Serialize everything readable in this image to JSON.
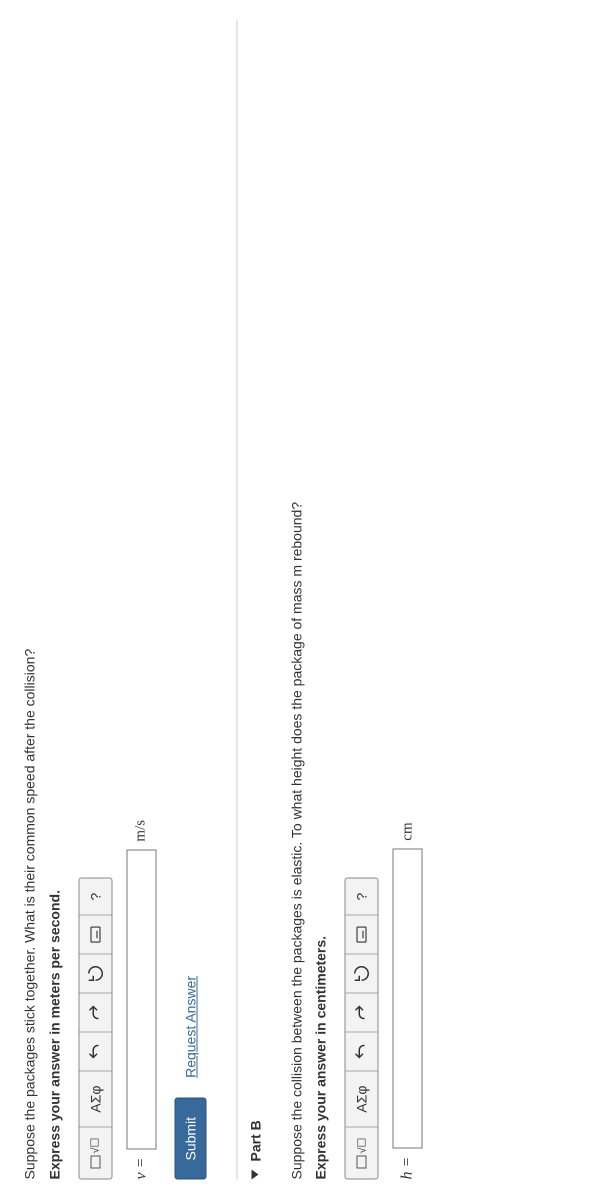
{
  "partA": {
    "question": "Suppose the packages stick together. What is their common speed after the collision?",
    "instruction": "Express your answer in meters per second.",
    "toolbar": {
      "templates": "",
      "symbols": "ΑΣφ",
      "undo": "",
      "redo": "",
      "reset": "",
      "keyboard": "",
      "help": "?"
    },
    "var": "v =",
    "unit": "m/s",
    "submit": "Submit",
    "request": "Request Answer"
  },
  "partB": {
    "header": "Part B",
    "question": "Suppose the collision between the packages is elastic. To what height does the package of mass m rebound?",
    "instruction": "Express your answer in centimeters.",
    "toolbar": {
      "symbols": "ΑΣφ",
      "help": "?"
    },
    "var": "h =",
    "unit": "cm"
  }
}
